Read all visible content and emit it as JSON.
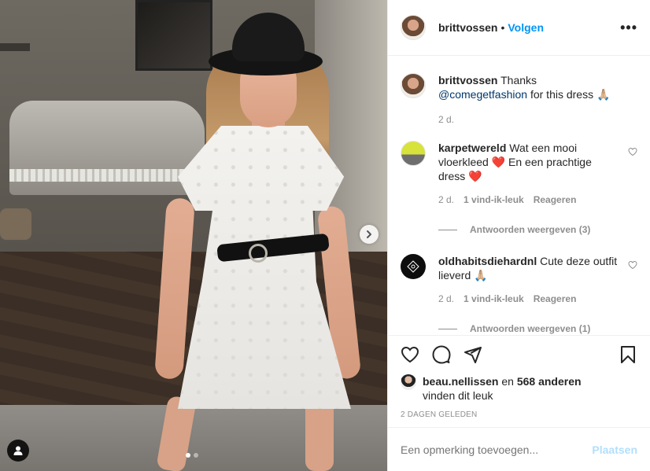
{
  "post": {
    "photo_count": 2,
    "active_photo": 1
  },
  "header": {
    "username": "brittvossen",
    "separator": "•",
    "follow_label": "Volgen",
    "more_label": "•••"
  },
  "caption": {
    "username": "brittvossen",
    "text_before": "Thanks ",
    "mention": "@comegetfashion",
    "text_after": " for this dress 🙏🏼",
    "time": "2 d."
  },
  "comments": [
    {
      "username": "karpetwereld",
      "text": "Wat een mooi vloerkleed ❤️ En een prachtige dress ❤️",
      "time": "2 d.",
      "likes": "1 vind-ik-leuk",
      "reply_label": "Reageren",
      "view_replies": "Antwoorden weergeven (3)"
    },
    {
      "username": "oldhabitsdiehardnl",
      "text": "Cute deze outfit lieverd 🙏🏼",
      "time": "2 d.",
      "likes": "1 vind-ik-leuk",
      "reply_label": "Reageren",
      "view_replies": "Antwoorden weergeven (1)"
    }
  ],
  "likes": {
    "liker": "beau.nellissen",
    "connector": " en ",
    "others": "568 anderen",
    "suffix": "vinden dit leuk"
  },
  "date": "2 DAGEN GELEDEN",
  "add_comment": {
    "placeholder": "Een opmerking toevoegen...",
    "post_label": "Plaatsen"
  },
  "icons": {
    "like": "heart-icon",
    "comment": "comment-icon",
    "share": "share-icon",
    "save": "bookmark-icon",
    "next": "chevron-right-icon",
    "tagged_user": "user-icon"
  },
  "colors": {
    "link": "#0095f6",
    "mention": "#00376b",
    "muted": "#8e8e8e",
    "post_disabled": "#b2dffc",
    "heart": "#ed4956"
  }
}
